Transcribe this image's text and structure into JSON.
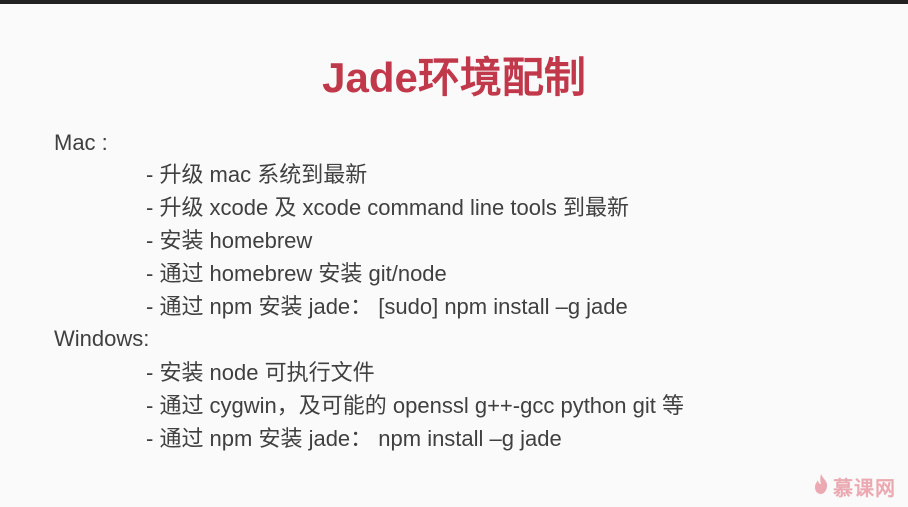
{
  "slide": {
    "title": "Jade环境配制",
    "sections": [
      {
        "heading": "Mac :",
        "items": [
          "- 升级 mac 系统到最新",
          "- 升级 xcode 及 xcode command line tools 到最新",
          "- 安装 homebrew",
          "- 通过 homebrew 安装 git/node",
          "- 通过 npm 安装 jade： [sudo] npm install –g jade"
        ]
      },
      {
        "heading": "Windows:",
        "items": [
          "- 安装 node 可执行文件",
          "- 通过 cygwin，及可能的 openssl g++-gcc python git 等",
          "- 通过 npm 安装 jade： npm install –g jade"
        ]
      }
    ]
  },
  "watermark": {
    "text": "慕课网",
    "icon": "flame-icon",
    "color": "#d9485a"
  },
  "colors": {
    "title": "#c0384a",
    "body_text": "#404040",
    "background": "#fafafa"
  }
}
